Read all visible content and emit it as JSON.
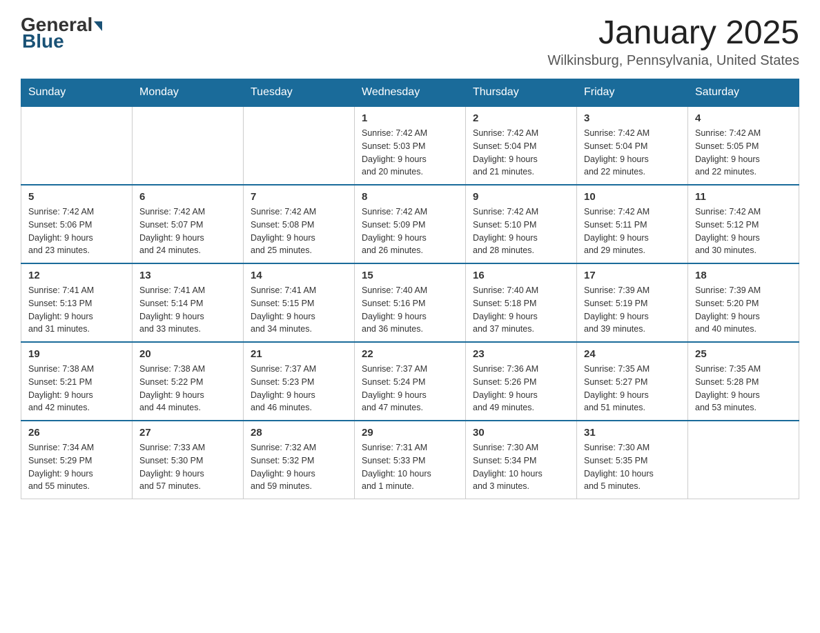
{
  "header": {
    "logo_general": "General",
    "logo_blue": "Blue",
    "month_title": "January 2025",
    "location": "Wilkinsburg, Pennsylvania, United States"
  },
  "weekdays": [
    "Sunday",
    "Monday",
    "Tuesday",
    "Wednesday",
    "Thursday",
    "Friday",
    "Saturday"
  ],
  "weeks": [
    [
      {
        "day": "",
        "info": ""
      },
      {
        "day": "",
        "info": ""
      },
      {
        "day": "",
        "info": ""
      },
      {
        "day": "1",
        "info": "Sunrise: 7:42 AM\nSunset: 5:03 PM\nDaylight: 9 hours\nand 20 minutes."
      },
      {
        "day": "2",
        "info": "Sunrise: 7:42 AM\nSunset: 5:04 PM\nDaylight: 9 hours\nand 21 minutes."
      },
      {
        "day": "3",
        "info": "Sunrise: 7:42 AM\nSunset: 5:04 PM\nDaylight: 9 hours\nand 22 minutes."
      },
      {
        "day": "4",
        "info": "Sunrise: 7:42 AM\nSunset: 5:05 PM\nDaylight: 9 hours\nand 22 minutes."
      }
    ],
    [
      {
        "day": "5",
        "info": "Sunrise: 7:42 AM\nSunset: 5:06 PM\nDaylight: 9 hours\nand 23 minutes."
      },
      {
        "day": "6",
        "info": "Sunrise: 7:42 AM\nSunset: 5:07 PM\nDaylight: 9 hours\nand 24 minutes."
      },
      {
        "day": "7",
        "info": "Sunrise: 7:42 AM\nSunset: 5:08 PM\nDaylight: 9 hours\nand 25 minutes."
      },
      {
        "day": "8",
        "info": "Sunrise: 7:42 AM\nSunset: 5:09 PM\nDaylight: 9 hours\nand 26 minutes."
      },
      {
        "day": "9",
        "info": "Sunrise: 7:42 AM\nSunset: 5:10 PM\nDaylight: 9 hours\nand 28 minutes."
      },
      {
        "day": "10",
        "info": "Sunrise: 7:42 AM\nSunset: 5:11 PM\nDaylight: 9 hours\nand 29 minutes."
      },
      {
        "day": "11",
        "info": "Sunrise: 7:42 AM\nSunset: 5:12 PM\nDaylight: 9 hours\nand 30 minutes."
      }
    ],
    [
      {
        "day": "12",
        "info": "Sunrise: 7:41 AM\nSunset: 5:13 PM\nDaylight: 9 hours\nand 31 minutes."
      },
      {
        "day": "13",
        "info": "Sunrise: 7:41 AM\nSunset: 5:14 PM\nDaylight: 9 hours\nand 33 minutes."
      },
      {
        "day": "14",
        "info": "Sunrise: 7:41 AM\nSunset: 5:15 PM\nDaylight: 9 hours\nand 34 minutes."
      },
      {
        "day": "15",
        "info": "Sunrise: 7:40 AM\nSunset: 5:16 PM\nDaylight: 9 hours\nand 36 minutes."
      },
      {
        "day": "16",
        "info": "Sunrise: 7:40 AM\nSunset: 5:18 PM\nDaylight: 9 hours\nand 37 minutes."
      },
      {
        "day": "17",
        "info": "Sunrise: 7:39 AM\nSunset: 5:19 PM\nDaylight: 9 hours\nand 39 minutes."
      },
      {
        "day": "18",
        "info": "Sunrise: 7:39 AM\nSunset: 5:20 PM\nDaylight: 9 hours\nand 40 minutes."
      }
    ],
    [
      {
        "day": "19",
        "info": "Sunrise: 7:38 AM\nSunset: 5:21 PM\nDaylight: 9 hours\nand 42 minutes."
      },
      {
        "day": "20",
        "info": "Sunrise: 7:38 AM\nSunset: 5:22 PM\nDaylight: 9 hours\nand 44 minutes."
      },
      {
        "day": "21",
        "info": "Sunrise: 7:37 AM\nSunset: 5:23 PM\nDaylight: 9 hours\nand 46 minutes."
      },
      {
        "day": "22",
        "info": "Sunrise: 7:37 AM\nSunset: 5:24 PM\nDaylight: 9 hours\nand 47 minutes."
      },
      {
        "day": "23",
        "info": "Sunrise: 7:36 AM\nSunset: 5:26 PM\nDaylight: 9 hours\nand 49 minutes."
      },
      {
        "day": "24",
        "info": "Sunrise: 7:35 AM\nSunset: 5:27 PM\nDaylight: 9 hours\nand 51 minutes."
      },
      {
        "day": "25",
        "info": "Sunrise: 7:35 AM\nSunset: 5:28 PM\nDaylight: 9 hours\nand 53 minutes."
      }
    ],
    [
      {
        "day": "26",
        "info": "Sunrise: 7:34 AM\nSunset: 5:29 PM\nDaylight: 9 hours\nand 55 minutes."
      },
      {
        "day": "27",
        "info": "Sunrise: 7:33 AM\nSunset: 5:30 PM\nDaylight: 9 hours\nand 57 minutes."
      },
      {
        "day": "28",
        "info": "Sunrise: 7:32 AM\nSunset: 5:32 PM\nDaylight: 9 hours\nand 59 minutes."
      },
      {
        "day": "29",
        "info": "Sunrise: 7:31 AM\nSunset: 5:33 PM\nDaylight: 10 hours\nand 1 minute."
      },
      {
        "day": "30",
        "info": "Sunrise: 7:30 AM\nSunset: 5:34 PM\nDaylight: 10 hours\nand 3 minutes."
      },
      {
        "day": "31",
        "info": "Sunrise: 7:30 AM\nSunset: 5:35 PM\nDaylight: 10 hours\nand 5 minutes."
      },
      {
        "day": "",
        "info": ""
      }
    ]
  ]
}
